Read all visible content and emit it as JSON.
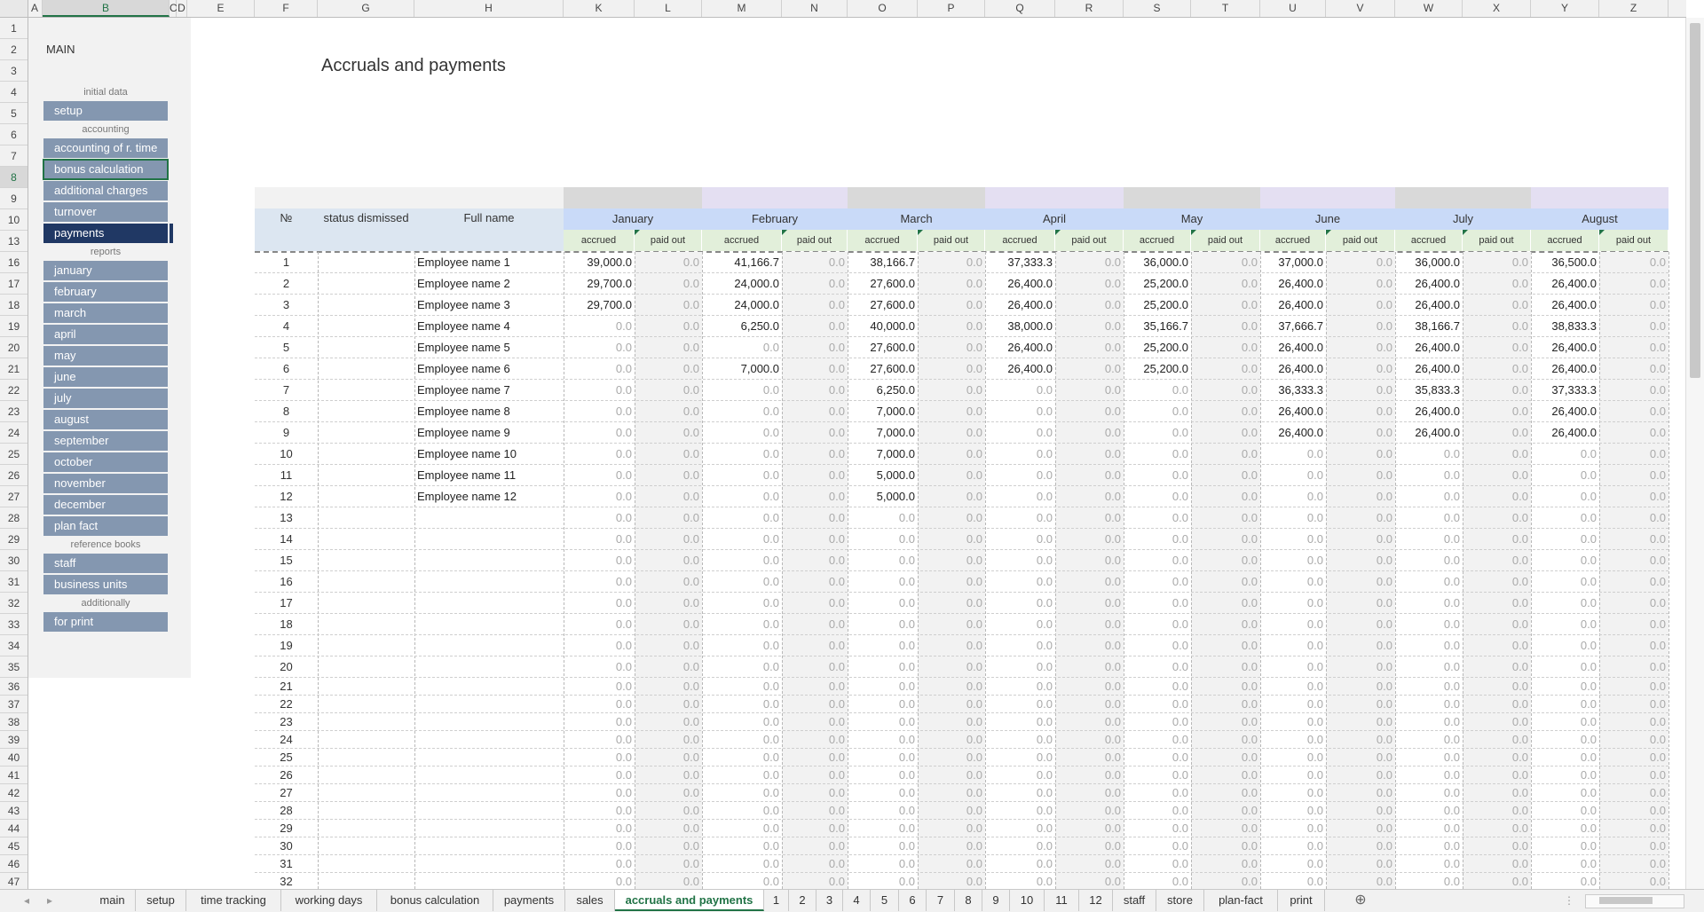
{
  "columns": [
    "A",
    "B",
    "C",
    "D",
    "E",
    "F",
    "G",
    "H",
    "K",
    "L",
    "M",
    "N",
    "O",
    "P",
    "Q",
    "R",
    "S",
    "T",
    "U",
    "V",
    "W",
    "X",
    "Y",
    "Z"
  ],
  "selected_column": "B",
  "rows": [
    "1",
    "2",
    "3",
    "4",
    "5",
    "6",
    "7",
    "8",
    "9",
    "10",
    "13",
    "16",
    "17",
    "18",
    "19",
    "20",
    "21",
    "22",
    "23",
    "24",
    "25",
    "26",
    "27",
    "28",
    "29",
    "30",
    "31",
    "32",
    "33",
    "34",
    "35",
    "36",
    "37",
    "38",
    "39",
    "40",
    "41",
    "42",
    "43",
    "44",
    "45",
    "46",
    "47"
  ],
  "selected_row": "8",
  "nav": {
    "title": "MAIN",
    "sections": [
      {
        "label": "initial data",
        "items": [
          "setup"
        ]
      },
      {
        "label": "accounting",
        "items": [
          "accounting of r. time",
          "bonus calculation",
          "additional charges",
          "turnover",
          "payments"
        ]
      },
      {
        "label": "reports",
        "items": [
          "january",
          "february",
          "march",
          "april",
          "may",
          "june",
          "july",
          "august",
          "september",
          "october",
          "november",
          "december",
          "plan fact"
        ]
      },
      {
        "label": "reference books",
        "items": [
          "staff",
          "business units"
        ]
      },
      {
        "label": "additionally",
        "items": [
          "for print"
        ]
      }
    ],
    "active_item": "payments",
    "selected_item": "bonus calculation"
  },
  "page_title": "Accruals and payments",
  "table": {
    "headers": {
      "num": "№",
      "status": "status dismissed",
      "name": "Full name"
    },
    "months": [
      "January",
      "February",
      "March",
      "April",
      "May",
      "June",
      "July",
      "August"
    ],
    "subheaders": {
      "accrued": "accrued",
      "paid": "paid out"
    },
    "employees": [
      {
        "num": "1",
        "name": "Employee name 1",
        "accrued": [
          "39,000.0",
          "41,166.7",
          "38,166.7",
          "37,333.3",
          "36,000.0",
          "37,000.0",
          "36,000.0",
          "36,500.0"
        ]
      },
      {
        "num": "2",
        "name": "Employee name 2",
        "accrued": [
          "29,700.0",
          "24,000.0",
          "27,600.0",
          "26,400.0",
          "25,200.0",
          "26,400.0",
          "26,400.0",
          "26,400.0"
        ]
      },
      {
        "num": "3",
        "name": "Employee name 3",
        "accrued": [
          "29,700.0",
          "24,000.0",
          "27,600.0",
          "26,400.0",
          "25,200.0",
          "26,400.0",
          "26,400.0",
          "26,400.0"
        ]
      },
      {
        "num": "4",
        "name": "Employee name 4",
        "accrued": [
          "0.0",
          "6,250.0",
          "40,000.0",
          "38,000.0",
          "35,166.7",
          "37,666.7",
          "38,166.7",
          "38,833.3"
        ]
      },
      {
        "num": "5",
        "name": "Employee name 5",
        "accrued": [
          "0.0",
          "0.0",
          "27,600.0",
          "26,400.0",
          "25,200.0",
          "26,400.0",
          "26,400.0",
          "26,400.0"
        ]
      },
      {
        "num": "6",
        "name": "Employee name 6",
        "accrued": [
          "0.0",
          "7,000.0",
          "27,600.0",
          "26,400.0",
          "25,200.0",
          "26,400.0",
          "26,400.0",
          "26,400.0"
        ]
      },
      {
        "num": "7",
        "name": "Employee name 7",
        "accrued": [
          "0.0",
          "0.0",
          "6,250.0",
          "0.0",
          "0.0",
          "36,333.3",
          "35,833.3",
          "37,333.3"
        ]
      },
      {
        "num": "8",
        "name": "Employee name 8",
        "accrued": [
          "0.0",
          "0.0",
          "7,000.0",
          "0.0",
          "0.0",
          "26,400.0",
          "26,400.0",
          "26,400.0"
        ]
      },
      {
        "num": "9",
        "name": "Employee name 9",
        "accrued": [
          "0.0",
          "0.0",
          "7,000.0",
          "0.0",
          "0.0",
          "26,400.0",
          "26,400.0",
          "26,400.0"
        ]
      },
      {
        "num": "10",
        "name": "Employee name 10",
        "accrued": [
          "0.0",
          "0.0",
          "7,000.0",
          "0.0",
          "0.0",
          "0.0",
          "0.0",
          "0.0"
        ]
      },
      {
        "num": "11",
        "name": "Employee name 11",
        "accrued": [
          "0.0",
          "0.0",
          "5,000.0",
          "0.0",
          "0.0",
          "0.0",
          "0.0",
          "0.0"
        ]
      },
      {
        "num": "12",
        "name": "Employee name 12",
        "accrued": [
          "0.0",
          "0.0",
          "5,000.0",
          "0.0",
          "0.0",
          "0.0",
          "0.0",
          "0.0"
        ]
      }
    ],
    "empty_row_numbers": [
      "13",
      "14",
      "15",
      "16",
      "17",
      "18",
      "19",
      "20",
      "21",
      "22",
      "23",
      "24",
      "25",
      "26",
      "27",
      "28",
      "29",
      "30",
      "31",
      "32"
    ],
    "paid_value": "0.0",
    "zero_value": "0.0"
  },
  "tabs": [
    "main",
    "setup",
    "time tracking",
    "working days",
    "bonus calculation",
    "payments",
    "sales",
    "accruals and payments",
    "1",
    "2",
    "3",
    "4",
    "5",
    "6",
    "7",
    "8",
    "9",
    "10",
    "11",
    "12",
    "staff",
    "store",
    "plan-fact",
    "print"
  ],
  "active_tab": "accruals and payments",
  "tab_nav": {
    "prev": "◂",
    "next": "▸",
    "add": "⊕",
    "more": "⋮"
  },
  "colors": {
    "accent": "#217346",
    "nav_button": "#8497b0",
    "nav_active": "#203864",
    "month_header": "#c9daf8",
    "subheader": "#e2efda"
  }
}
